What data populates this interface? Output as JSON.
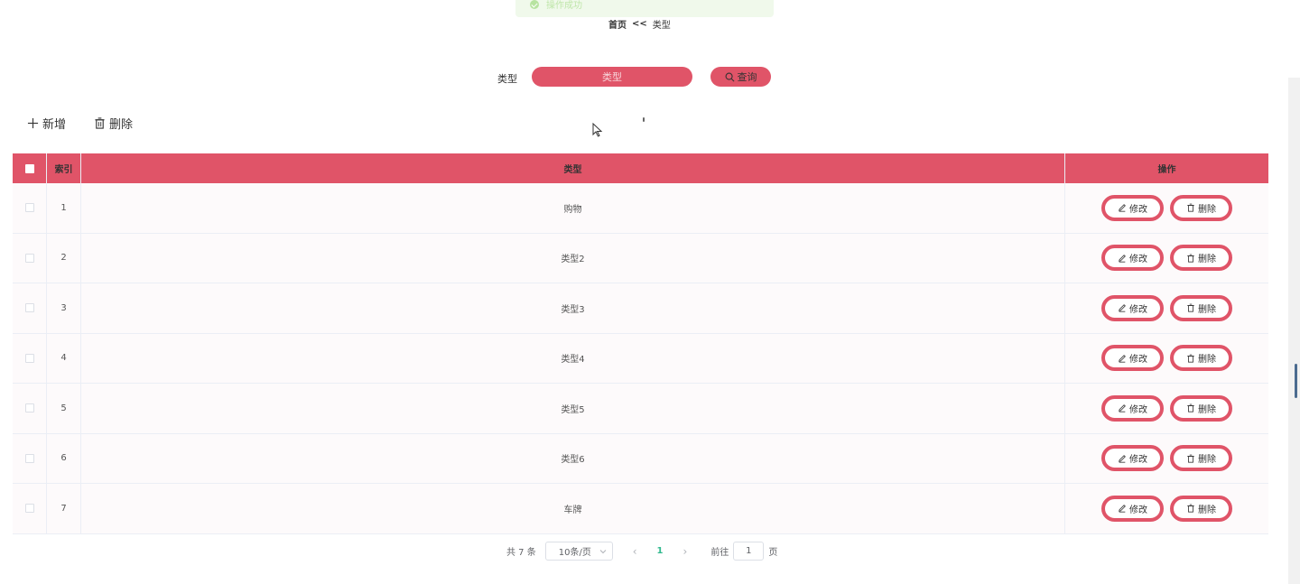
{
  "toast": {
    "message": "操作成功"
  },
  "breadcrumb": {
    "home": "首页",
    "separator": "<<",
    "current": "类型"
  },
  "search": {
    "label": "类型",
    "placeholder": "类型",
    "button": "查询"
  },
  "toolbar": {
    "add": "新增",
    "delete": "删除"
  },
  "table": {
    "headers": {
      "index": "索引",
      "type": "类型",
      "ops": "操作"
    },
    "rows": [
      {
        "index": "1",
        "type": "购物"
      },
      {
        "index": "2",
        "type": "类型2"
      },
      {
        "index": "3",
        "type": "类型3"
      },
      {
        "index": "4",
        "type": "类型4"
      },
      {
        "index": "5",
        "type": "类型5"
      },
      {
        "index": "6",
        "type": "类型6"
      },
      {
        "index": "7",
        "type": "车牌"
      }
    ],
    "edit_label": "修改",
    "delete_label": "删除"
  },
  "pagination": {
    "total": "共 7 条",
    "page_size": "10条/页",
    "current_page": "1",
    "goto_label": "前往",
    "goto_value": "1",
    "page_suffix": "页"
  },
  "colors": {
    "accent": "#e05468",
    "success": "#31b98e"
  }
}
